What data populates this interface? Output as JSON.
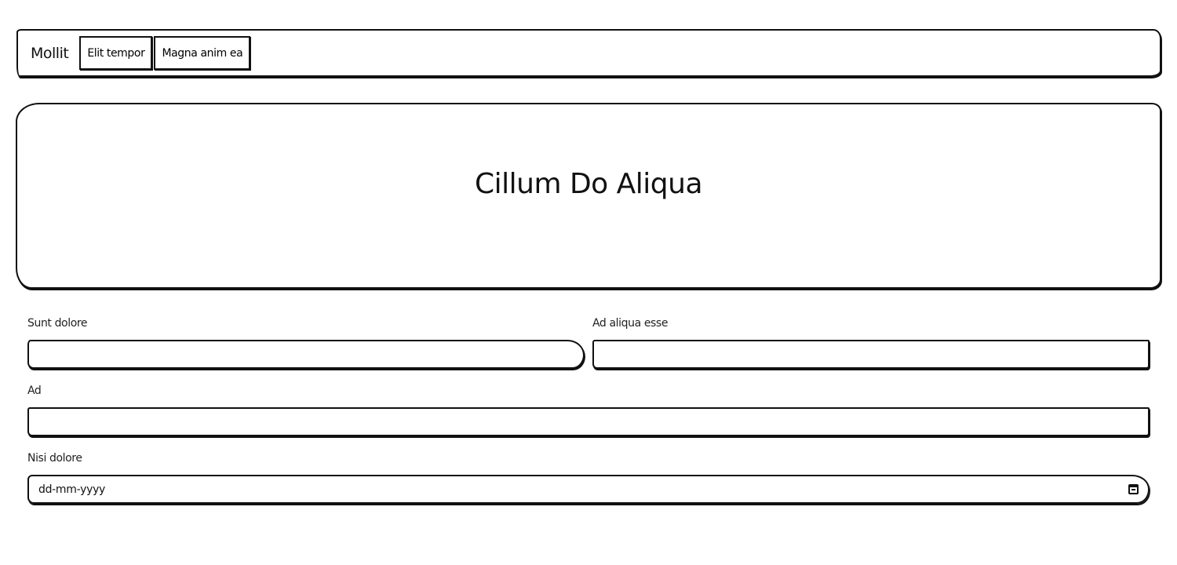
{
  "navbar": {
    "brand": "Mollit",
    "items": [
      {
        "label": "Elit tempor"
      },
      {
        "label": "Magna anim ea"
      }
    ]
  },
  "hero": {
    "title": "Cillum Do Aliqua"
  },
  "form": {
    "field1": {
      "label": "Sunt dolore",
      "value": ""
    },
    "field2": {
      "label": "Ad aliqua esse",
      "value": ""
    },
    "field3": {
      "label": "Ad",
      "value": ""
    },
    "date": {
      "label": "Nisi dolore",
      "placeholder": "dd-mm-yyyy",
      "icon": "calendar-icon"
    }
  }
}
